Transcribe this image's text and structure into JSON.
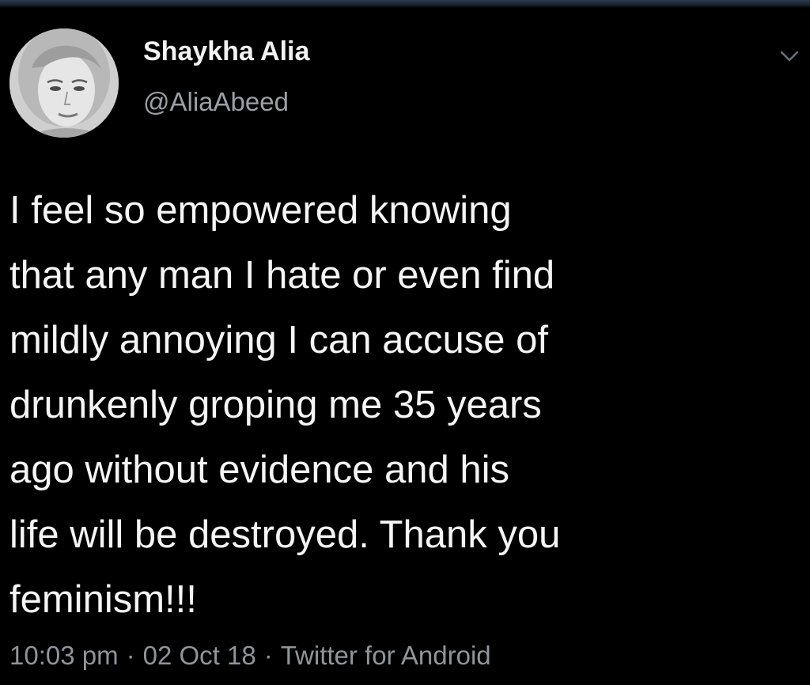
{
  "colors": {
    "background": "#000000",
    "text": "#f5f5f5",
    "secondary_text": "#8f959b"
  },
  "tweet": {
    "author": {
      "display_name": "Shaykha Alia",
      "handle": "@AliaAbeed",
      "avatar_icon": "profile-photo"
    },
    "menu_icon": "chevron-down-icon",
    "text_lines": [
      "I feel so empowered knowing",
      "that any man I hate or even find",
      "mildly annoying I can accuse of",
      "drunkenly groping me 35 years",
      "ago without evidence and his",
      "life will be destroyed. Thank you",
      "feminism!!!"
    ],
    "meta": {
      "time": "10:03 pm",
      "separator": "·",
      "date": "02 Oct 18",
      "source": "Twitter for Android"
    }
  }
}
